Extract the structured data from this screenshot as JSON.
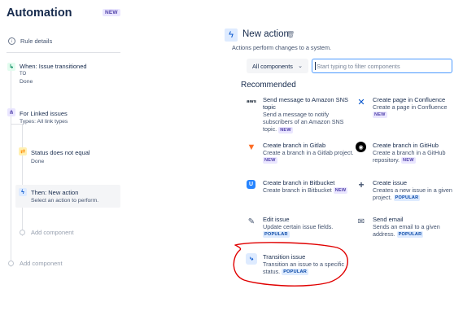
{
  "app": {
    "title": "Automation",
    "badge": "NEW"
  },
  "sidebar": {
    "rule_details": "Rule details",
    "steps": {
      "trigger": {
        "title": "When: Issue transitioned",
        "line2": "TO",
        "line3": "Done"
      },
      "branch": {
        "title": "For Linked issues",
        "subtitle": "Types: All link types"
      },
      "condition": {
        "title": "Status does not equal",
        "subtitle": "Done"
      },
      "action": {
        "title": "Then: New action",
        "subtitle": "Select an action to perform."
      }
    },
    "add_component_inner": "Add component",
    "add_component_outer": "Add component"
  },
  "panel": {
    "title": "New action",
    "description": "Actions perform changes to a system.",
    "filter_select": "All components",
    "filter_placeholder": "Start typing to filter components",
    "section_title": "Recommended"
  },
  "actions": [
    {
      "icon": "aws-icon",
      "title": "Send message to Amazon SNS topic",
      "description": "Send a message to notify subscribers of an Amazon SNS topic.",
      "badge": "NEW"
    },
    {
      "icon": "confluence-icon",
      "title": "Create page in Confluence",
      "description": "Create a page in Confluence",
      "badge": "NEW"
    },
    {
      "icon": "gitlab-icon",
      "title": "Create branch in Gitlab",
      "description": "Create a branch in a Gitlab project.",
      "badge": "NEW"
    },
    {
      "icon": "github-icon",
      "title": "Create branch in GitHub",
      "description": "Create a branch in a GitHub repository.",
      "badge": "NEW"
    },
    {
      "icon": "bitbucket-icon",
      "title": "Create branch in Bitbucket",
      "description": "Create branch in Bitbucket",
      "badge": "NEW"
    },
    {
      "icon": "plus-icon",
      "title": "Create issue",
      "description": "Creates a new issue in a given project.",
      "badge": "POPULAR"
    },
    {
      "icon": "pencil-icon",
      "title": "Edit issue",
      "description": "Update certain issue fields.",
      "badge": "POPULAR"
    },
    {
      "icon": "mail-icon",
      "title": "Send email",
      "description": "Sends an email to a given address.",
      "badge": "POPULAR"
    },
    {
      "icon": "transition-icon",
      "title": "Transition issue",
      "description": "Transition an issue to a specific status.",
      "badge": "POPULAR"
    }
  ],
  "annotation": {
    "color": "#e00000"
  },
  "colors": {
    "accent": "#0052cc",
    "focus": "#4c9aff",
    "text": "#172b4d"
  }
}
